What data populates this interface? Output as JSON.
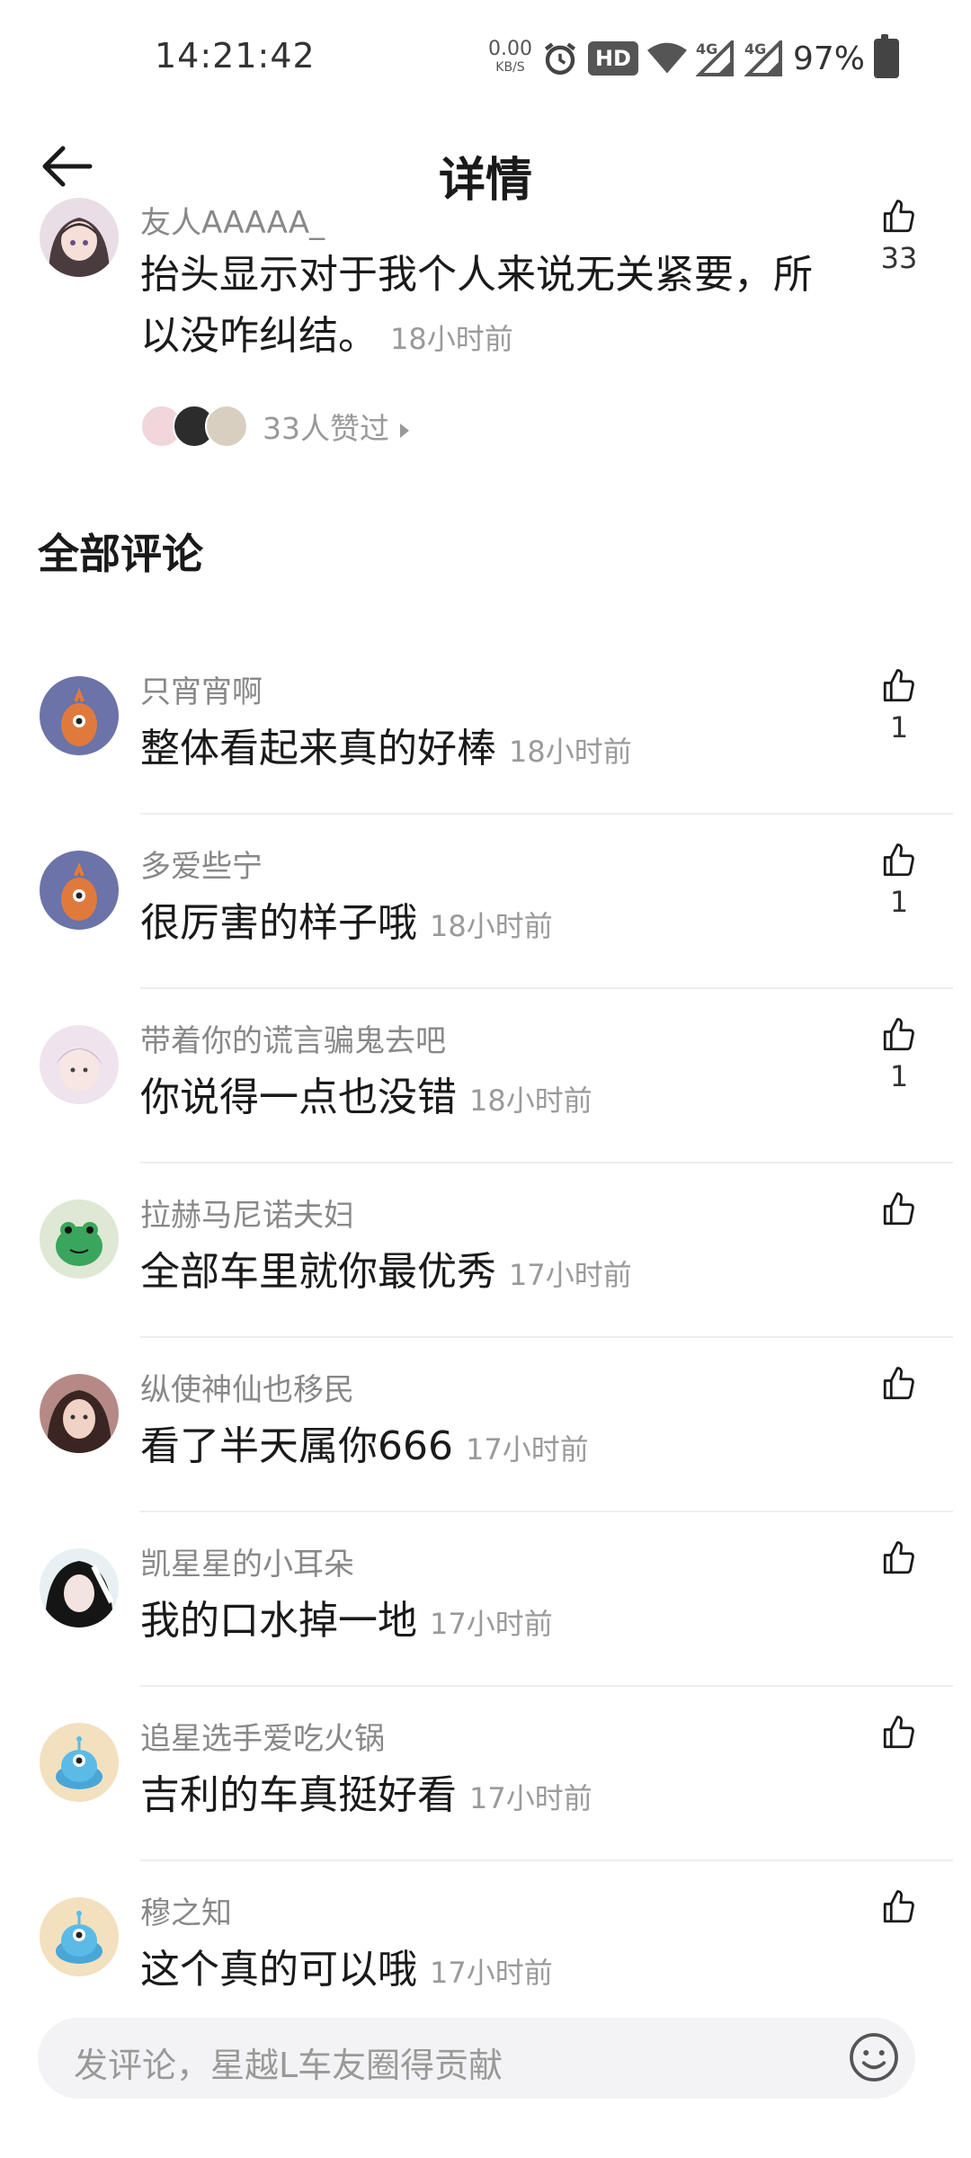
{
  "status_bar": {
    "time": "14:21:42",
    "net_speed": "0.00",
    "net_unit": "KB/S",
    "hd_label": "HD",
    "net_type_1": "4G",
    "net_type_2": "4G",
    "battery": "97%"
  },
  "header": {
    "title": "详情"
  },
  "main_comment": {
    "author": "友人AAAAA_",
    "text": "抬头显示对于我个人来说无关紧要，所以没咋纠结。",
    "time": "18小时前",
    "likes": "33",
    "likers_text": "33人赞过"
  },
  "section": {
    "title": "全部评论"
  },
  "comments": [
    {
      "author": "只宵宵啊",
      "text": "整体看起来真的好棒",
      "time": "18小时前",
      "likes": "1"
    },
    {
      "author": "多爱些宁",
      "text": "很厉害的样子哦",
      "time": "18小时前",
      "likes": "1"
    },
    {
      "author": "带着你的谎言骗鬼去吧",
      "text": "你说得一点也没错",
      "time": "18小时前",
      "likes": "1"
    },
    {
      "author": "拉赫马尼诺夫妇",
      "text": "全部车里就你最优秀",
      "time": "17小时前",
      "likes": ""
    },
    {
      "author": "纵使神仙也移民",
      "text": "看了半天属你666",
      "time": "17小时前",
      "likes": ""
    },
    {
      "author": "凯星星的小耳朵",
      "text": "我的口水掉一地",
      "time": "17小时前",
      "likes": ""
    },
    {
      "author": "追星选手爱吃火锅",
      "text": "吉利的车真挺好看",
      "time": "17小时前",
      "likes": ""
    },
    {
      "author": "穆之知",
      "text": "这个真的可以哦",
      "time": "17小时前",
      "likes": ""
    }
  ],
  "input": {
    "placeholder": "发评论，星越L车友圈得贡献"
  },
  "colors": {
    "text_primary": "#1a1a1a",
    "text_secondary": "#888888",
    "divider": "#eeeeee",
    "input_bg": "#f3f3f5"
  }
}
